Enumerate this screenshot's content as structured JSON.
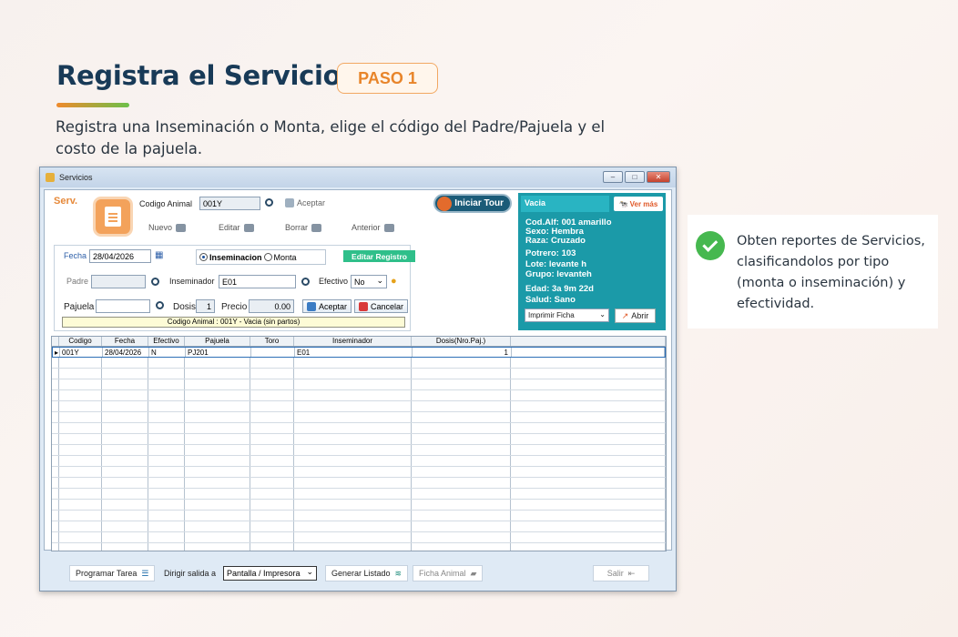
{
  "heading": {
    "title": "Registra el Servicio",
    "step": "PASO 1",
    "subtitle": "Registra una Inseminación o Monta, elige el código del Padre/Pajuela y el costo de la pajuela."
  },
  "window": {
    "title": "Servicios",
    "section": "Serv.",
    "codigo_label": "Codigo Animal",
    "codigo_value": "001Y",
    "aceptar_top": "Aceptar",
    "actions": {
      "nuevo": "Nuevo",
      "editar": "Editar",
      "borrar": "Borrar",
      "anterior": "Anterior"
    },
    "tour": "Iniciar Tour",
    "panel": {
      "status": "Vacia",
      "ver_mas": "Ver más",
      "cod": "Cod.Alf: 001 amarillo",
      "sexo": "Sexo: Hembra",
      "raza": "Raza: Cruzado",
      "potrero": "Potrero: 103",
      "lote": "Lote: levante h",
      "grupo": "Grupo: levanteh",
      "edad": "Edad: 3a 9m 22d",
      "salud": "Salud: Sano",
      "ficha_select": "Imprimir Ficha",
      "abrir": "Abrir"
    },
    "form": {
      "fecha_label": "Fecha",
      "fecha_value": "28/04/2026",
      "radio_inseminacion": "Inseminacion",
      "radio_monta": "Monta",
      "editar_registro": "Editar Registro",
      "padre_label": "Padre",
      "padre_value": "",
      "inseminador_label": "Inseminador",
      "inseminador_value": "E01",
      "efectivo_label": "Efectivo",
      "efectivo_value": "No",
      "pajuela_label": "Pajuela",
      "pajuela_value": "",
      "dosis_label": "Dosis",
      "dosis_value": "1",
      "precio_label": "Precio",
      "precio_value": "0.00",
      "aceptar": "Aceptar",
      "cancelar": "Cancelar",
      "status_line": "Codigo Animal : 001Y - Vacia (sin partos)"
    },
    "grid": {
      "headers": [
        "Codigo",
        "Fecha",
        "Efectivo",
        "Pajuela",
        "Toro",
        "Inseminador",
        "Dosis(Nro.Paj.)"
      ],
      "rows": [
        [
          "001Y",
          "28/04/2026",
          "N",
          "PJ201",
          "",
          "E01",
          "1"
        ]
      ]
    },
    "bottom": {
      "programar": "Programar Tarea",
      "dirigir": "Dirigir salida a",
      "salida_value": "Pantalla / Impresora",
      "generar": "Generar Listado",
      "ficha": "Ficha Animal",
      "salir": "Salir"
    }
  },
  "note": {
    "text": "Obten reportes de Servicios, clasificandolos por tipo (monta o inseminación) y efectividad."
  },
  "colors": {
    "accent": "#e8852a",
    "teal": "#1b9aa8",
    "title": "#183a57",
    "check": "#46b84f"
  }
}
